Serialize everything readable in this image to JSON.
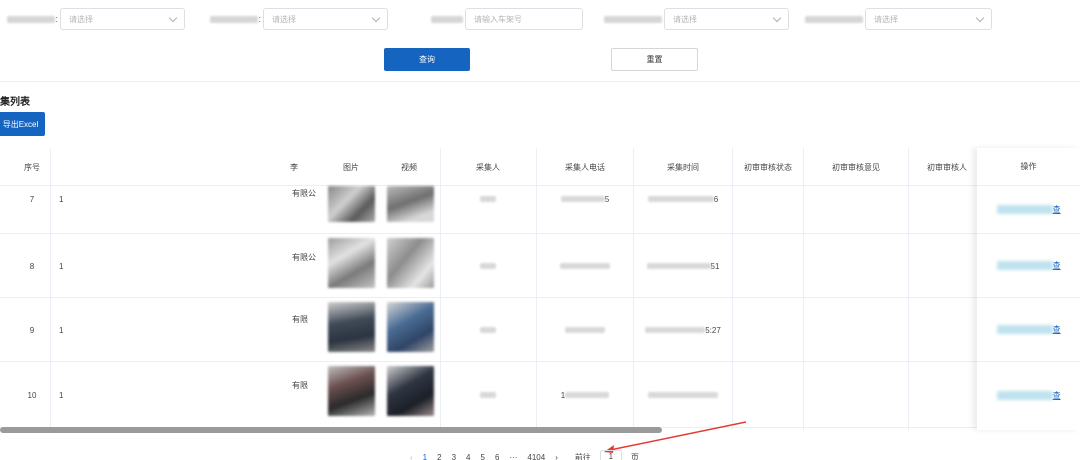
{
  "filters": {
    "select1_placeholder": "请选择",
    "select2_placeholder": "请选择",
    "plate_placeholder": "请输入车架号",
    "select4_placeholder": "请选择",
    "select5_placeholder": "请选择",
    "label_colon": ":"
  },
  "buttons": {
    "query": "查询",
    "reset": "重置",
    "export": "导出Excel"
  },
  "section": {
    "title": "集列表"
  },
  "table": {
    "headers": {
      "index": "序号",
      "col_partial": "李",
      "image": "图片",
      "video": "视频",
      "collector": "采集人",
      "collector_phone": "采集人电话",
      "collect_time": "采集时间",
      "first_review_status": "初审审核状态",
      "first_review_opinion": "初审审核意见",
      "first_reviewer": "初审审核人",
      "actions": "操作"
    },
    "rows": [
      {
        "index": "7",
        "col2": "1",
        "company": "有限公",
        "phone_tail": "5",
        "time_tail": "6",
        "action": "查"
      },
      {
        "index": "8",
        "col2": "1",
        "company": "有限公",
        "phone_tail": "",
        "time_tail": "51",
        "action": "查"
      },
      {
        "index": "9",
        "col2": "1",
        "company": "有限",
        "phone_tail": "",
        "time_tail": "5:27",
        "action": "查"
      },
      {
        "index": "10",
        "col2": "1",
        "company": "有限",
        "phone_tail": "1",
        "time_tail": "",
        "action": "查"
      }
    ]
  },
  "pagination": {
    "prev": "‹",
    "pages": [
      "1",
      "2",
      "3",
      "4",
      "5",
      "6"
    ],
    "ellipsis": "···",
    "last": "4104",
    "next": "›",
    "goto_label": "前往",
    "goto_value": "1",
    "page_unit": "页",
    "current": "1"
  },
  "colors": {
    "primary": "#1565c0",
    "annotation_arrow": "#e53935"
  }
}
